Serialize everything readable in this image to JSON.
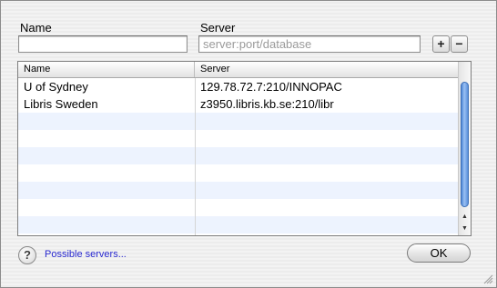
{
  "form": {
    "name_label": "Name",
    "name_value": "",
    "server_label": "Server",
    "server_placeholder": "server:port/database",
    "add_label": "+",
    "remove_label": "−"
  },
  "table": {
    "columns": [
      "Name",
      "Server"
    ],
    "rows": [
      {
        "name": "U of Sydney",
        "server": "129.78.72.7:210/INNOPAC"
      },
      {
        "name": "Libris Sweden",
        "server": "z3950.libris.kb.se:210/libr"
      }
    ]
  },
  "footer": {
    "help_label": "?",
    "possible_servers_link": "Possible servers...",
    "ok_label": "OK"
  },
  "icons": {
    "scroll_up": "triangle-up",
    "scroll_down": "triangle-down",
    "resize": "resize-grip"
  }
}
